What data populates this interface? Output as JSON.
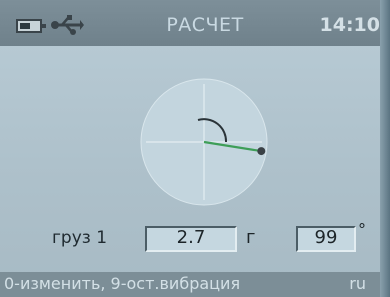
{
  "header": {
    "battery_icon": "battery-icon",
    "usb_icon": "usb-icon",
    "title": "РАСЧЕТ",
    "time": "14:10"
  },
  "main": {
    "weight_label": "груз 1",
    "mass_value": "2.7",
    "mass_unit": "г",
    "angle_value": "99",
    "angle_unit": "°",
    "angle_deg": 99
  },
  "footer": {
    "hint": "0-изменить, 9-ост.вибрация",
    "language": "ru"
  }
}
